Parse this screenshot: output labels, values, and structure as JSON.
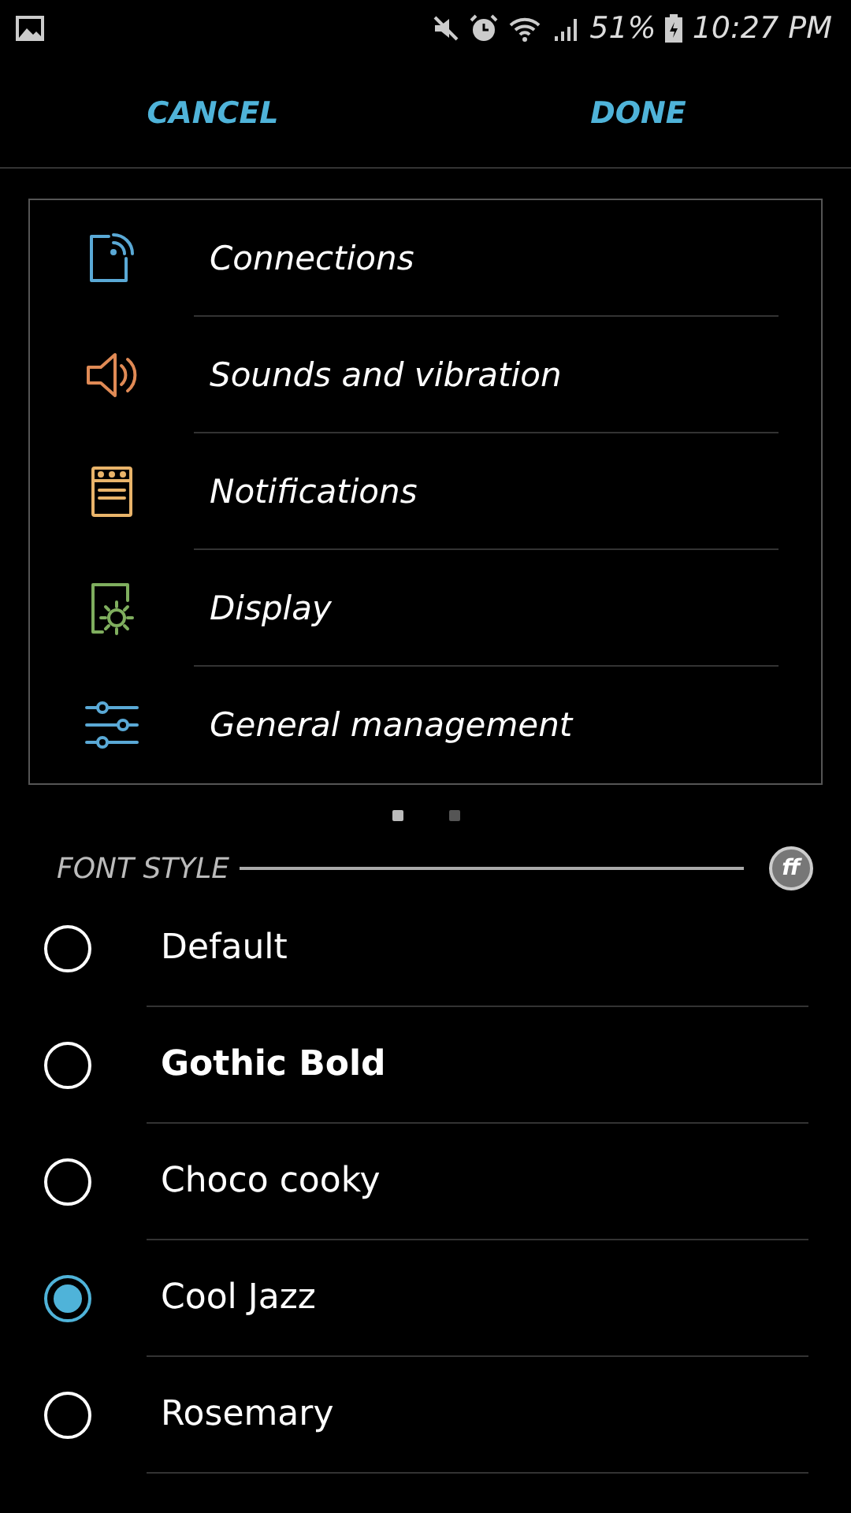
{
  "status_bar": {
    "battery": "51%",
    "time": "10:27 PM"
  },
  "header": {
    "cancel": "CANCEL",
    "done": "DONE"
  },
  "preview": {
    "items": [
      {
        "label": "Connections",
        "kind": "connections",
        "color": "#5aa9d6"
      },
      {
        "label": "Sounds and vibration",
        "kind": "sound",
        "color": "#e08a55"
      },
      {
        "label": "Notifications",
        "kind": "notifications",
        "color": "#e9b46a"
      },
      {
        "label": "Display",
        "kind": "display",
        "color": "#7fae5e"
      },
      {
        "label": "General management",
        "kind": "sliders",
        "color": "#5aa9d6"
      }
    ],
    "pages": [
      {
        "selected": true
      },
      {
        "selected": false
      }
    ]
  },
  "font_style": {
    "title": "FONT STYLE",
    "badge": "ff",
    "options": [
      {
        "label": "Default",
        "kind": "regular",
        "selected": false
      },
      {
        "label": "Gothic Bold",
        "kind": "bold",
        "selected": false
      },
      {
        "label": "Choco cooky",
        "kind": "regular",
        "selected": false
      },
      {
        "label": "Cool Jazz",
        "kind": "regular",
        "selected": true
      },
      {
        "label": "Rosemary",
        "kind": "regular",
        "selected": false
      }
    ]
  }
}
